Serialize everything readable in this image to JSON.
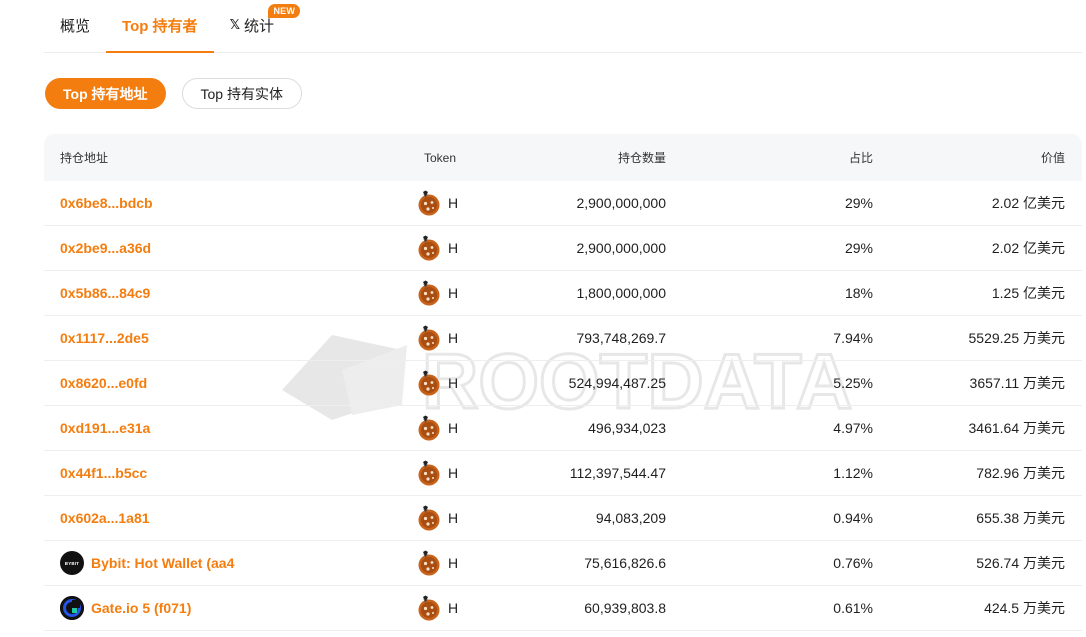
{
  "tabs": [
    {
      "label": "概览"
    },
    {
      "label": "Top 持有者"
    },
    {
      "label": "统计",
      "badge": "NEW"
    }
  ],
  "pills": [
    {
      "label": "Top 持有地址"
    },
    {
      "label": "Top 持有实体"
    }
  ],
  "table": {
    "headers": {
      "address": "持仓地址",
      "token": "Token",
      "quantity": "持仓数量",
      "share": "占比",
      "value": "价值"
    },
    "rows": [
      {
        "address": "0x6be8...bdcb",
        "token": "H",
        "quantity": "2,900,000,000",
        "share": "29%",
        "value": "2.02 亿美元"
      },
      {
        "address": "0x2be9...a36d",
        "token": "H",
        "quantity": "2,900,000,000",
        "share": "29%",
        "value": "2.02 亿美元"
      },
      {
        "address": "0x5b86...84c9",
        "token": "H",
        "quantity": "1,800,000,000",
        "share": "18%",
        "value": "1.25 亿美元"
      },
      {
        "address": "0x1117...2de5",
        "token": "H",
        "quantity": "793,748,269.7",
        "share": "7.94%",
        "value": "5529.25 万美元"
      },
      {
        "address": "0x8620...e0fd",
        "token": "H",
        "quantity": "524,994,487.25",
        "share": "5.25%",
        "value": "3657.11 万美元"
      },
      {
        "address": "0xd191...e31a",
        "token": "H",
        "quantity": "496,934,023",
        "share": "4.97%",
        "value": "3461.64 万美元"
      },
      {
        "address": "0x44f1...b5cc",
        "token": "H",
        "quantity": "112,397,544.47",
        "share": "1.12%",
        "value": "782.96 万美元"
      },
      {
        "address": "0x602a...1a81",
        "token": "H",
        "quantity": "94,083,209",
        "share": "0.94%",
        "value": "655.38 万美元"
      },
      {
        "address": "Bybit: Hot Wallet (aa4",
        "logo": "BYBIT",
        "token": "H",
        "quantity": "75,616,826.6",
        "share": "0.76%",
        "value": "526.74 万美元"
      },
      {
        "address": "Gate.io 5 (f071)",
        "logo": "gate",
        "token": "H",
        "quantity": "60,939,803.8",
        "share": "0.61%",
        "value": "424.5 万美元"
      }
    ]
  },
  "watermark": "ROOTDATA",
  "colors": {
    "accent": "#f47d0f",
    "token_icon": "#c8621a"
  },
  "icons": {
    "token": "cookie-token-icon",
    "x": "x-logo-icon"
  }
}
